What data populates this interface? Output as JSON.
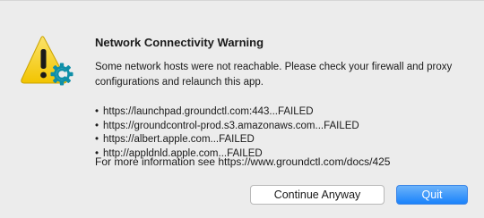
{
  "dialog": {
    "title": "Network Connectivity Warning",
    "message": "Some network hosts were not reachable. Please check your firewall and proxy configurations and relaunch this app.",
    "bullet": "•",
    "hosts": [
      "https://launchpad.groundctl.com:443...FAILED",
      "https://groundcontrol-prod.s3.amazonaws.com...FAILED",
      "https://albert.apple.com...FAILED",
      "http://appldnld.apple.com...FAILED"
    ],
    "more_info": "For more information see https://www.groundctl.com/docs/425",
    "icon": "warning-triangle-with-gear-badge",
    "buttons": {
      "continue_label": "Continue Anyway",
      "quit_label": "Quit"
    }
  },
  "colors": {
    "background": "#ececec",
    "warning_yellow": "#f5d21c",
    "badge_teal": "#0f8fa8",
    "primary_button": "#1a82fb"
  }
}
